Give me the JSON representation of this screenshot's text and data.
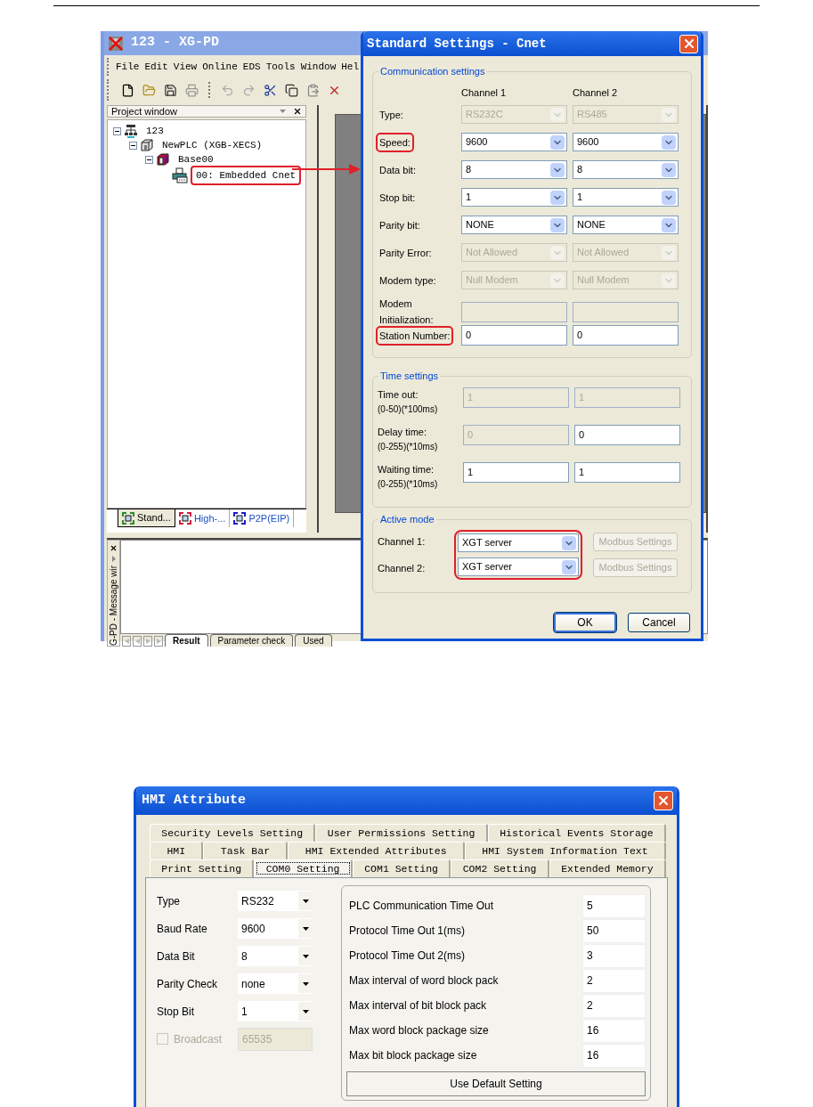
{
  "main_window": {
    "title": "123 - XG-PD",
    "menu": [
      "File",
      "Edit",
      "View",
      "Online",
      "EDS",
      "Tools",
      "Window",
      "Hel"
    ],
    "project_window": {
      "title": "Project window",
      "tree": [
        {
          "label": "123",
          "kind": "project",
          "expanded": true,
          "highlighted": false,
          "children": [
            {
              "label": "NewPLC (XGB-XECS)",
              "kind": "plc",
              "expanded": true,
              "highlighted": false,
              "children": [
                {
                  "label": "Base00",
                  "kind": "base",
                  "expanded": true,
                  "highlighted": false,
                  "children": [
                    {
                      "label": "00: Embedded Cnet",
                      "kind": "module",
                      "highlighted": true
                    }
                  ]
                }
              ]
            }
          ]
        }
      ],
      "tabs": [
        {
          "label": "Stand...",
          "selected": true,
          "color": "#2e8b2e"
        },
        {
          "label": "High-...",
          "selected": false,
          "color": "#cc1f3d"
        },
        {
          "label": "P2P(EIP)",
          "selected": false,
          "color": "#1a1acc"
        }
      ]
    },
    "message_window": {
      "title": "G-PD - Message wir",
      "tabs": [
        {
          "label": "Result",
          "selected": true
        },
        {
          "label": "Parameter check",
          "selected": false
        },
        {
          "label": "Used",
          "selected": false
        }
      ]
    }
  },
  "cnet_dialog": {
    "title": "Standard Settings - Cnet",
    "communication": {
      "title": "Communication settings",
      "columns": [
        "Channel 1",
        "Channel 2"
      ],
      "rows": [
        {
          "label": "Type:",
          "highlighted": false,
          "fields": [
            {
              "kind": "combo",
              "value": "RS232C",
              "disabled": true
            },
            {
              "kind": "combo",
              "value": "RS485",
              "disabled": true
            }
          ]
        },
        {
          "label": "Speed:",
          "highlighted": true,
          "fields": [
            {
              "kind": "combo",
              "value": "9600",
              "disabled": false
            },
            {
              "kind": "combo",
              "value": "9600",
              "disabled": false
            }
          ]
        },
        {
          "label": "Data bit:",
          "highlighted": false,
          "fields": [
            {
              "kind": "combo",
              "value": "8",
              "disabled": false
            },
            {
              "kind": "combo",
              "value": "8",
              "disabled": false
            }
          ]
        },
        {
          "label": "Stop bit:",
          "highlighted": false,
          "fields": [
            {
              "kind": "combo",
              "value": "1",
              "disabled": false
            },
            {
              "kind": "combo",
              "value": "1",
              "disabled": false
            }
          ]
        },
        {
          "label": "Parity bit:",
          "highlighted": false,
          "fields": [
            {
              "kind": "combo",
              "value": "NONE",
              "disabled": false
            },
            {
              "kind": "combo",
              "value": "NONE",
              "disabled": false
            }
          ]
        },
        {
          "label": "Parity Error:",
          "highlighted": false,
          "fields": [
            {
              "kind": "combo",
              "value": "Not Allowed",
              "disabled": true
            },
            {
              "kind": "combo",
              "value": "Not Allowed",
              "disabled": true
            }
          ]
        },
        {
          "label": "Modem type:",
          "highlighted": false,
          "fields": [
            {
              "kind": "combo",
              "value": "Null Modem",
              "disabled": true
            },
            {
              "kind": "combo",
              "value": "Null Modem",
              "disabled": true
            }
          ]
        },
        {
          "label": "Modem Initialization:",
          "highlighted": false,
          "fields": [
            {
              "kind": "text",
              "disabled": true
            },
            {
              "kind": "text",
              "disabled": true
            }
          ]
        },
        {
          "label": "Station Number:",
          "highlighted": true,
          "fields": [
            {
              "kind": "text",
              "value": "0",
              "disabled": false
            },
            {
              "kind": "text",
              "value": "0",
              "disabled": false
            }
          ]
        }
      ]
    },
    "time": {
      "title": "Time settings",
      "rows": [
        {
          "label": "Time out:",
          "hint": "(0-50)(*100ms)",
          "fields": [
            {
              "kind": "text",
              "value": "1",
              "disabled": true
            },
            {
              "kind": "text",
              "value": "1",
              "disabled": true
            }
          ]
        },
        {
          "label": "Delay time:",
          "hint": "(0-255)(*10ms)",
          "fields": [
            {
              "kind": "text",
              "value": "0",
              "disabled": true
            },
            {
              "kind": "text",
              "value": "0",
              "disabled": false
            }
          ]
        },
        {
          "label": "Waiting time:",
          "hint": "(0-255)(*10ms)",
          "fields": [
            {
              "kind": "text",
              "value": "1",
              "disabled": false
            },
            {
              "kind": "text",
              "value": "1",
              "disabled": false
            }
          ]
        }
      ]
    },
    "active_mode": {
      "title": "Active mode",
      "highlighted": true,
      "rows": [
        {
          "label": "Channel 1:",
          "value": "XGT server",
          "button": "Modbus Settings",
          "button_disabled": true
        },
        {
          "label": "Channel 2:",
          "value": "XGT server",
          "button": "Modbus Settings",
          "button_disabled": true
        }
      ]
    },
    "buttons": [
      {
        "label": "OK",
        "default": true
      },
      {
        "label": "Cancel",
        "default": false
      }
    ]
  },
  "hmi_dialog": {
    "title": "HMI Attribute",
    "tab_rows": [
      [
        {
          "label": "Security Levels Setting",
          "selected": false
        },
        {
          "label": "User Permissions Setting",
          "selected": false
        },
        {
          "label": "Historical Events Storage",
          "selected": false
        }
      ],
      [
        {
          "label": "HMI",
          "selected": false
        },
        {
          "label": "Task Bar",
          "selected": false
        },
        {
          "label": "HMI Extended Attributes",
          "selected": false
        },
        {
          "label": "HMI System Information Text",
          "selected": false
        }
      ],
      [
        {
          "label": "Print Setting",
          "selected": false
        },
        {
          "label": "COM0 Setting",
          "selected": true
        },
        {
          "label": "COM1 Setting",
          "selected": false
        },
        {
          "label": "COM2 Setting",
          "selected": false
        },
        {
          "label": "Extended Memory",
          "selected": false
        }
      ]
    ],
    "serial": [
      {
        "label": "Type",
        "value": "RS232"
      },
      {
        "label": "Baud Rate",
        "value": "9600"
      },
      {
        "label": "Data Bit",
        "value": "8"
      },
      {
        "label": "Parity Check",
        "value": "none"
      },
      {
        "label": "Stop Bit",
        "value": "1"
      }
    ],
    "broadcast": {
      "label": "Broadcast",
      "checked": false,
      "disabled": true,
      "value": "65535"
    },
    "timing": [
      {
        "label": "PLC Communication Time Out",
        "value": "5"
      },
      {
        "label": "Protocol Time Out 1(ms)",
        "value": "50"
      },
      {
        "label": "Protocol Time Out 2(ms)",
        "value": "3"
      },
      {
        "label": "Max interval of word block pack",
        "value": "2"
      },
      {
        "label": "Max interval of bit block pack",
        "value": "2"
      },
      {
        "label": "Max word block package size",
        "value": "16"
      },
      {
        "label": "Max bit block package size",
        "value": "16"
      }
    ],
    "default_button": "Use Default Setting"
  }
}
